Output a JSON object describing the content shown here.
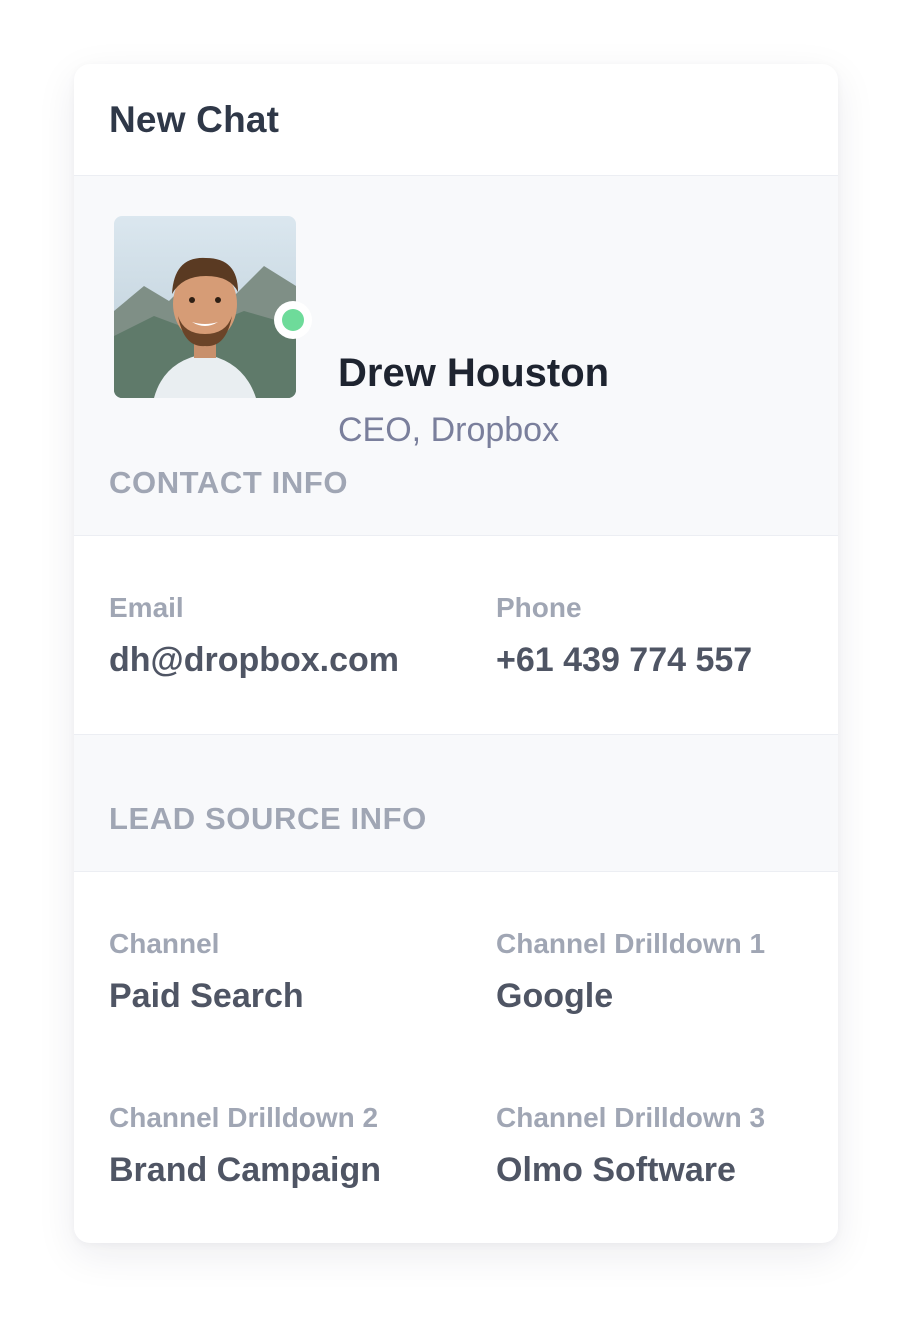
{
  "header": {
    "title": "New Chat"
  },
  "profile": {
    "name": "Drew Houston",
    "role": "CEO, Dropbox",
    "status_color": "#6edb9a"
  },
  "contact": {
    "section_label": "CONTACT INFO",
    "email_label": "Email",
    "email_value": "dh@dropbox.com",
    "phone_label": "Phone",
    "phone_value": "+61  439 774 557"
  },
  "lead": {
    "section_label": "LEAD SOURCE INFO",
    "channel_label": "Channel",
    "channel_value": "Paid Search",
    "drilldown1_label": "Channel Drilldown 1",
    "drilldown1_value": "Google",
    "drilldown2_label": "Channel Drilldown 2",
    "drilldown2_value": "Brand Campaign",
    "drilldown3_label": "Channel Drilldown 3",
    "drilldown3_value": "Olmo Software"
  }
}
